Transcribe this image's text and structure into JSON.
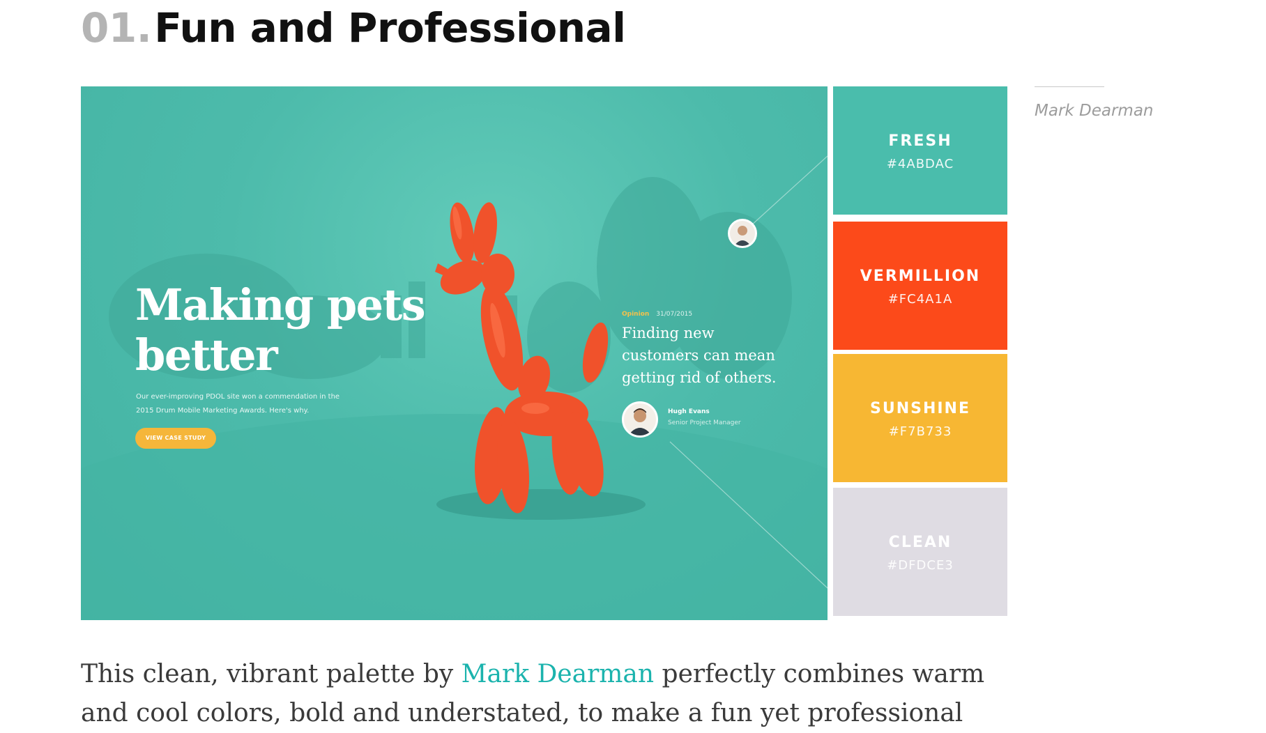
{
  "heading": {
    "number": "01.",
    "title": "Fun and Professional"
  },
  "hero": {
    "title": "Making pets better",
    "subtitle": "Our ever-improving PDOL site won a commendation in the 2015 Drum Mobile Marketing Awards. Here's why.",
    "cta_label": "VIEW CASE STUDY",
    "quote_tag": "Opinion",
    "quote_date": "31/07/2015",
    "quote_text": "Finding new customers can mean getting rid of others.",
    "author_name": "Hugh Evans",
    "author_role": "Senior Project Manager"
  },
  "palette": [
    {
      "name": "FRESH",
      "hex": "#4ABDAC",
      "color": "#4abdac",
      "text_color": "#ffffff"
    },
    {
      "name": "VERMILLION",
      "hex": "#FC4A1A",
      "color": "#fc4a1a",
      "text_color": "#ffffff"
    },
    {
      "name": "SUNSHINE",
      "hex": "#F7B733",
      "color": "#f7b733",
      "text_color": "#ffffff"
    },
    {
      "name": "CLEAN",
      "hex": "#DFDCE3",
      "color": "#dfdce3",
      "text_color": "#ffffff"
    }
  ],
  "caption": "Mark Dearman",
  "body": {
    "before_link": "This clean, vibrant palette by ",
    "link_text": "Mark Dearman",
    "after_link": " perfectly combines warm",
    "next_line": "and cool colors, bold and understated, to make a fun yet professional"
  },
  "colors": {
    "link": "#1bb3ad",
    "heading_number": "#b4b4b4",
    "hero_bg": "#4dbbab"
  }
}
